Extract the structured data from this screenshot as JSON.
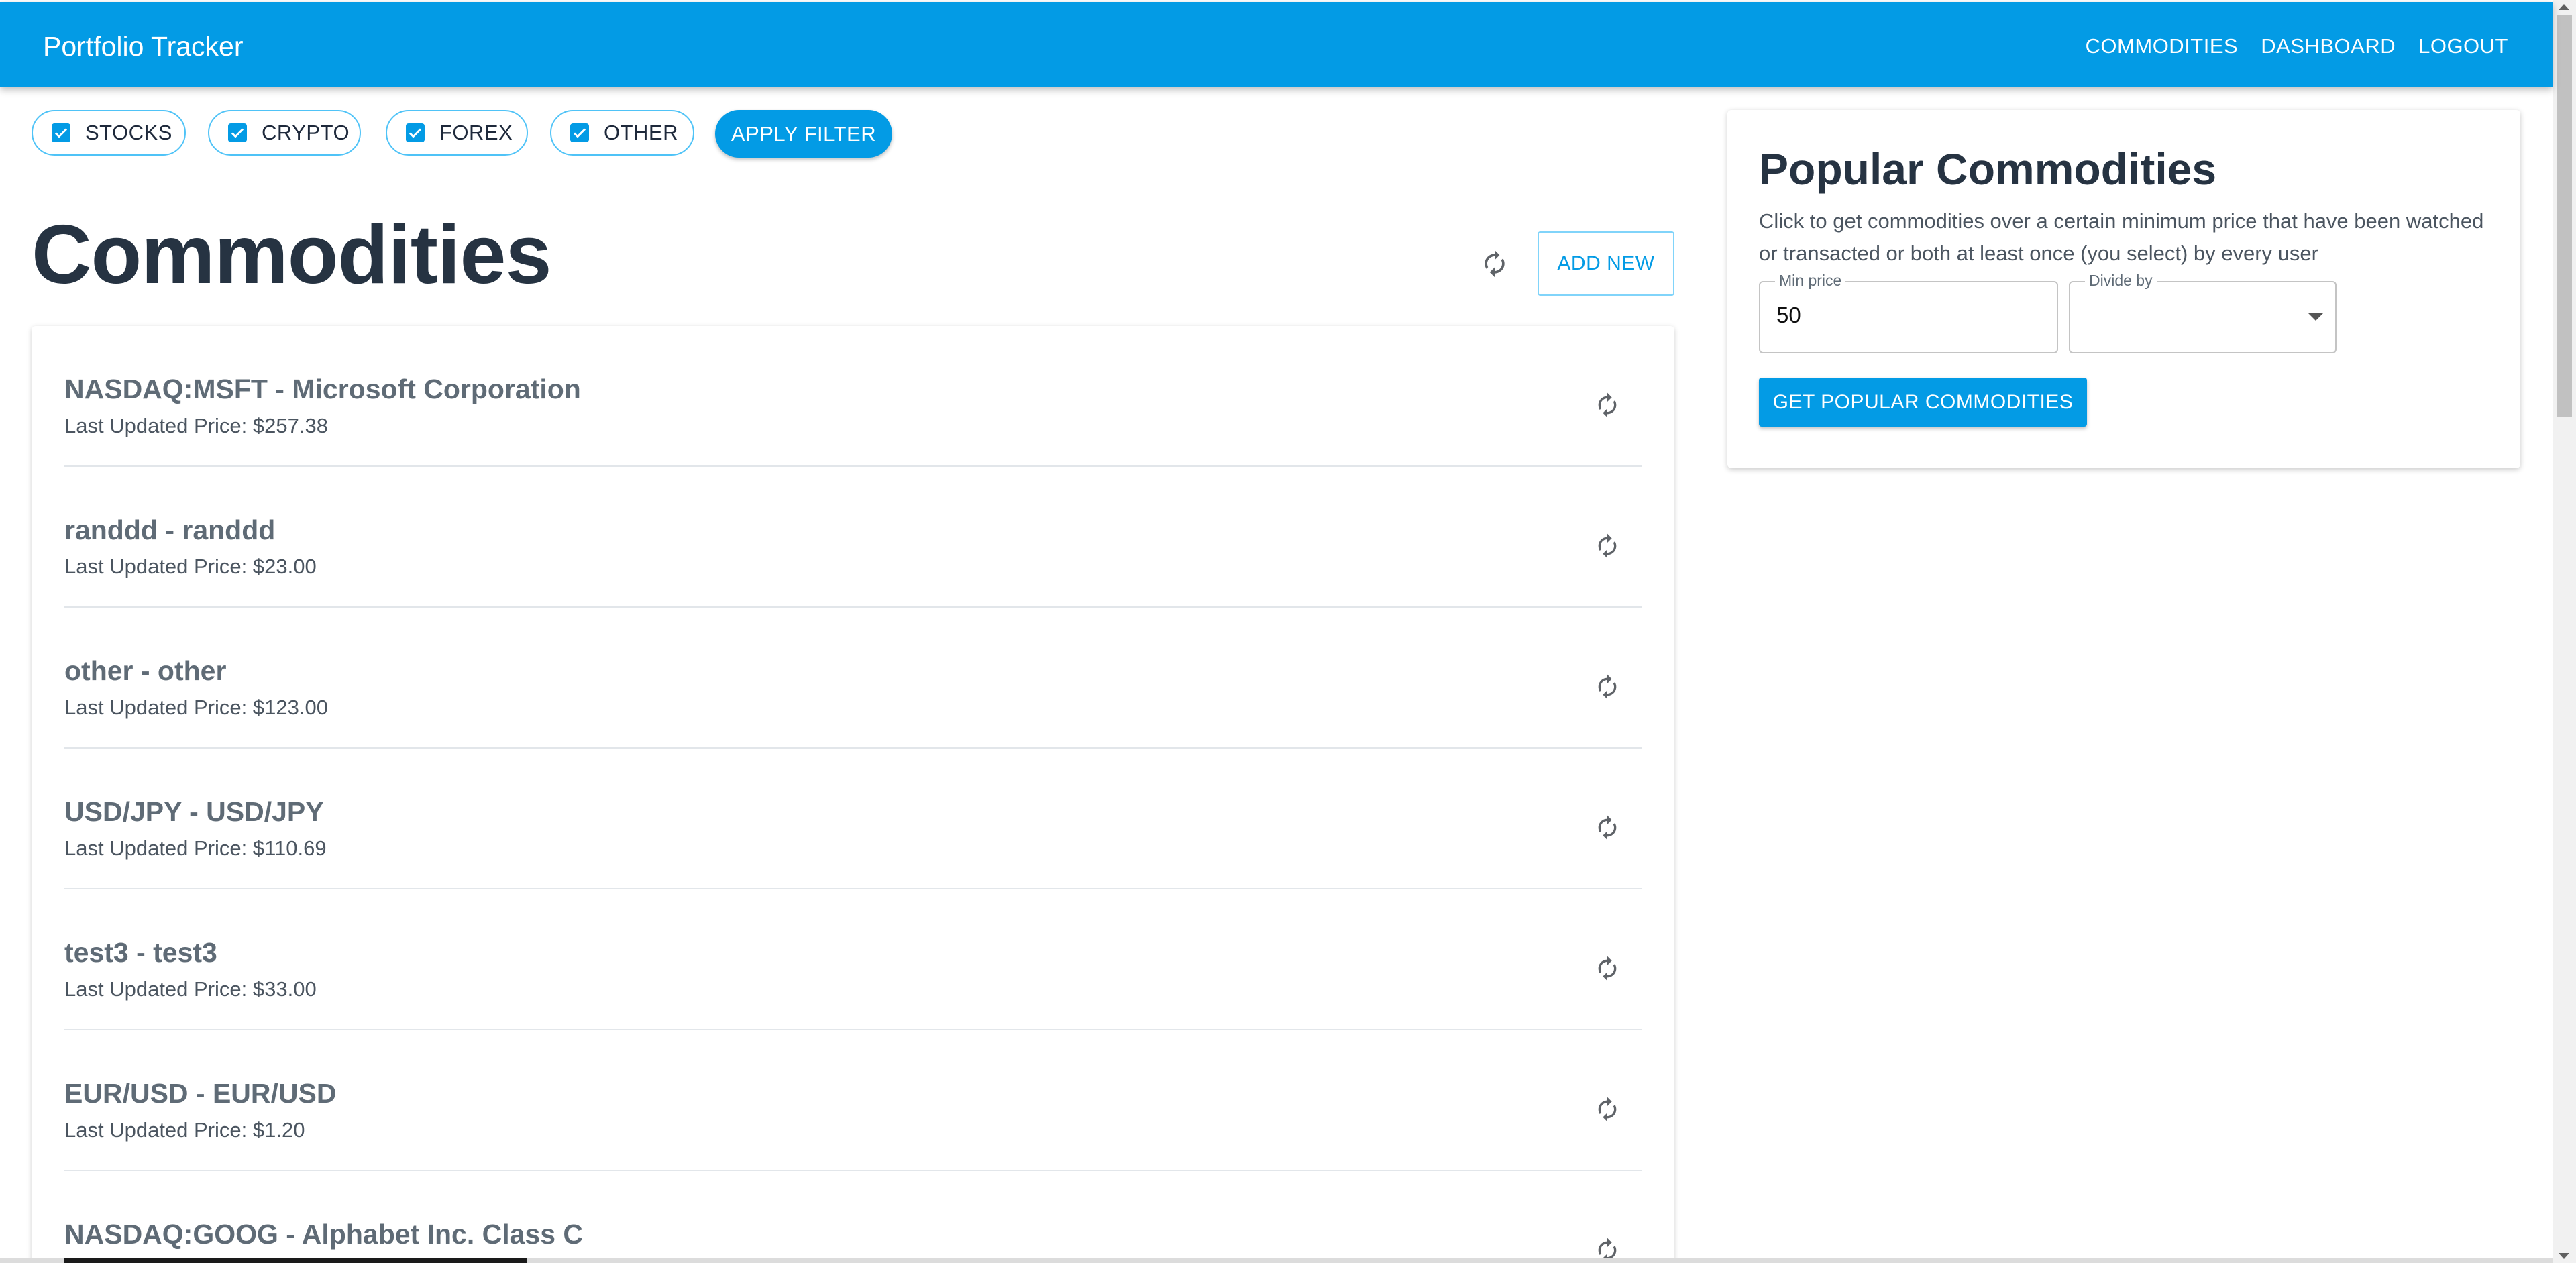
{
  "app": {
    "title": "Portfolio Tracker",
    "nav": [
      "COMMODITIES",
      "DASHBOARD",
      "LOGOUT"
    ]
  },
  "filters": {
    "chips": [
      {
        "label": "STOCKS",
        "checked": true
      },
      {
        "label": "CRYPTO",
        "checked": true
      },
      {
        "label": "FOREX",
        "checked": true
      },
      {
        "label": "OTHER",
        "checked": true
      }
    ],
    "apply_label": "APPLY FILTER"
  },
  "main": {
    "title": "Commodities",
    "add_new_label": "ADD NEW",
    "items": [
      {
        "title": "NASDAQ:MSFT - Microsoft Corporation",
        "price": "Last Updated Price: $257.38"
      },
      {
        "title": "randdd - randdd",
        "price": "Last Updated Price: $23.00"
      },
      {
        "title": "other - other",
        "price": "Last Updated Price: $123.00"
      },
      {
        "title": "USD/JPY - USD/JPY",
        "price": "Last Updated Price: $110.69"
      },
      {
        "title": "test3 - test3",
        "price": "Last Updated Price: $33.00"
      },
      {
        "title": "EUR/USD - EUR/USD",
        "price": "Last Updated Price: $1.20"
      },
      {
        "title": "NASDAQ:GOOG - Alphabet Inc. Class C",
        "price": ""
      }
    ]
  },
  "popular": {
    "title": "Popular Commodities",
    "description": "Click to get commodities over a certain minimum price that have been watched or transacted or both at least once (you select) by every user",
    "min_price_label": "Min price",
    "min_price_value": "50",
    "divide_by_label": "Divide by",
    "divide_by_value": "",
    "button_label": "GET POPULAR COMMODITIES"
  },
  "colors": {
    "primary": "#039be5",
    "heading": "#263342",
    "text_muted": "#4b5560"
  },
  "icons": {
    "refresh": "refresh-icon",
    "checkbox": "checkbox-checked-icon",
    "dropdown": "chevron-down-icon"
  }
}
